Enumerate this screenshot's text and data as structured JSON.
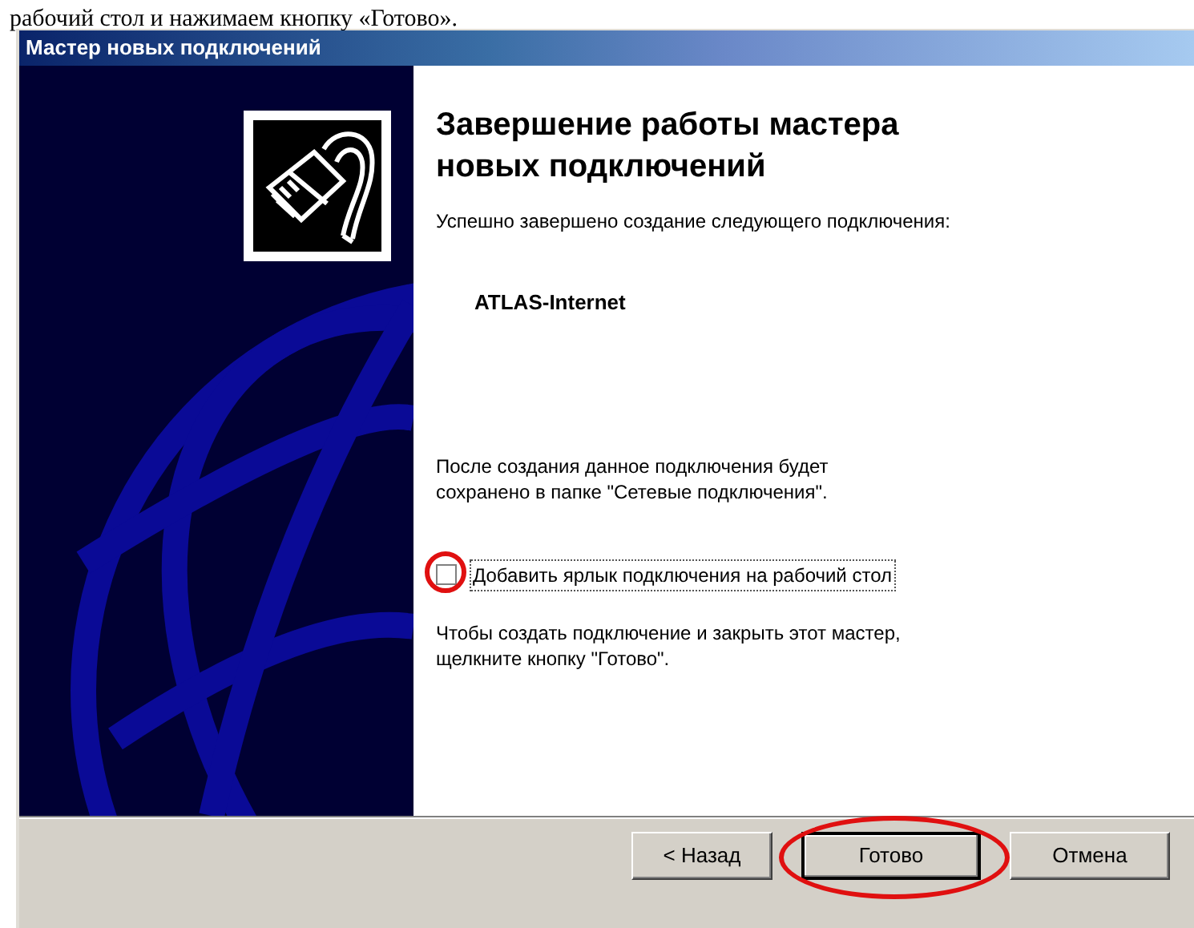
{
  "caption": "рабочий стол и нажимаем кнопку «Готово».",
  "window": {
    "title": "Мастер новых подключений"
  },
  "heading": "Завершение работы мастера новых подключений",
  "intro": "Успешно завершено создание следующего подключения:",
  "connection_name": "ATLAS-Internet",
  "note": "После создания данное подключения будет сохранено в папке \"Сетевые подключения\".",
  "shortcut_checkbox": {
    "label": "Добавить ярлык подключения на рабочий стол",
    "checked": false,
    "highlighted": true
  },
  "finish_hint": "Чтобы создать подключение и закрыть этот мастер, щелкните кнопку \"Готово\".",
  "buttons": [
    {
      "label": "< Назад",
      "default": false,
      "highlighted": false
    },
    {
      "label": "Готово",
      "default": true,
      "highlighted": true
    },
    {
      "label": "Отмена",
      "default": false,
      "highlighted": false
    }
  ]
}
